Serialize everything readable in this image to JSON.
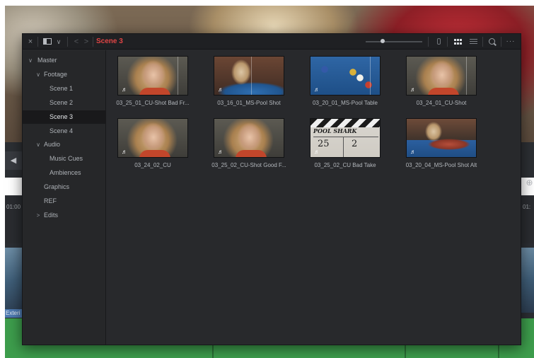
{
  "backdrop": {
    "left_nav_glyph": "◀",
    "right_glyph": "⊕",
    "timecode_left": "01:00",
    "timecode_right": "01:",
    "clip_label": "Exteri"
  },
  "toolbar": {
    "close_glyph": "×",
    "view_caret": "∨",
    "back_glyph": "<",
    "forward_glyph": ">",
    "current_bin": "Scene 3",
    "more_glyph": "···",
    "icons": {
      "close": "close-icon",
      "view": "panel-layout-icon",
      "sort": "sort-icon",
      "thumbnail_view": "grid-icon",
      "list_view": "list-icon",
      "search": "search-icon",
      "more": "more-icon"
    },
    "colors": {
      "current_bin": "#e04545"
    }
  },
  "sidebar": {
    "items": [
      {
        "label": "Master",
        "arrow": "∨",
        "selected": false
      },
      {
        "label": "Footage",
        "arrow": "∨",
        "selected": false
      },
      {
        "label": "Scene 1",
        "arrow": "",
        "selected": false
      },
      {
        "label": "Scene 2",
        "arrow": "",
        "selected": false
      },
      {
        "label": "Scene 3",
        "arrow": "",
        "selected": true
      },
      {
        "label": "Scene 4",
        "arrow": "",
        "selected": false
      },
      {
        "label": "Audio",
        "arrow": "∨",
        "selected": false
      },
      {
        "label": "Music Cues",
        "arrow": "",
        "selected": false
      },
      {
        "label": "Ambiences",
        "arrow": "",
        "selected": false
      },
      {
        "label": "Graphics",
        "arrow": "",
        "selected": false
      },
      {
        "label": "REF",
        "arrow": "",
        "selected": false
      },
      {
        "label": "Edits",
        "arrow": ">",
        "selected": false
      }
    ]
  },
  "clips": [
    {
      "name": "03_25_01_CU-Shot Bad Fr...",
      "look": "face",
      "audio_icon": "♬"
    },
    {
      "name": "03_16_01_MS-Pool Shot",
      "look": "poolshot",
      "audio_icon": "♬"
    },
    {
      "name": "03_20_01_MS-Pool Table",
      "look": "pool",
      "audio_icon": "♬"
    },
    {
      "name": "03_24_01_CU-Shot",
      "look": "face",
      "audio_icon": "♬"
    },
    {
      "name": "03_24_02_CU",
      "look": "face",
      "audio_icon": "♬"
    },
    {
      "name": "03_25_02_CU-Shot Good F...",
      "look": "face",
      "audio_icon": "♬"
    },
    {
      "name": "03_25_02_CU Bad Take",
      "look": "slate",
      "audio_icon": "♬"
    },
    {
      "name": "03_20_04_MS-Pool Shot Alt",
      "look": "altpool",
      "audio_icon": "♬"
    }
  ],
  "slate": {
    "title": "POOL SHARK",
    "scene": "25",
    "take": "2"
  }
}
